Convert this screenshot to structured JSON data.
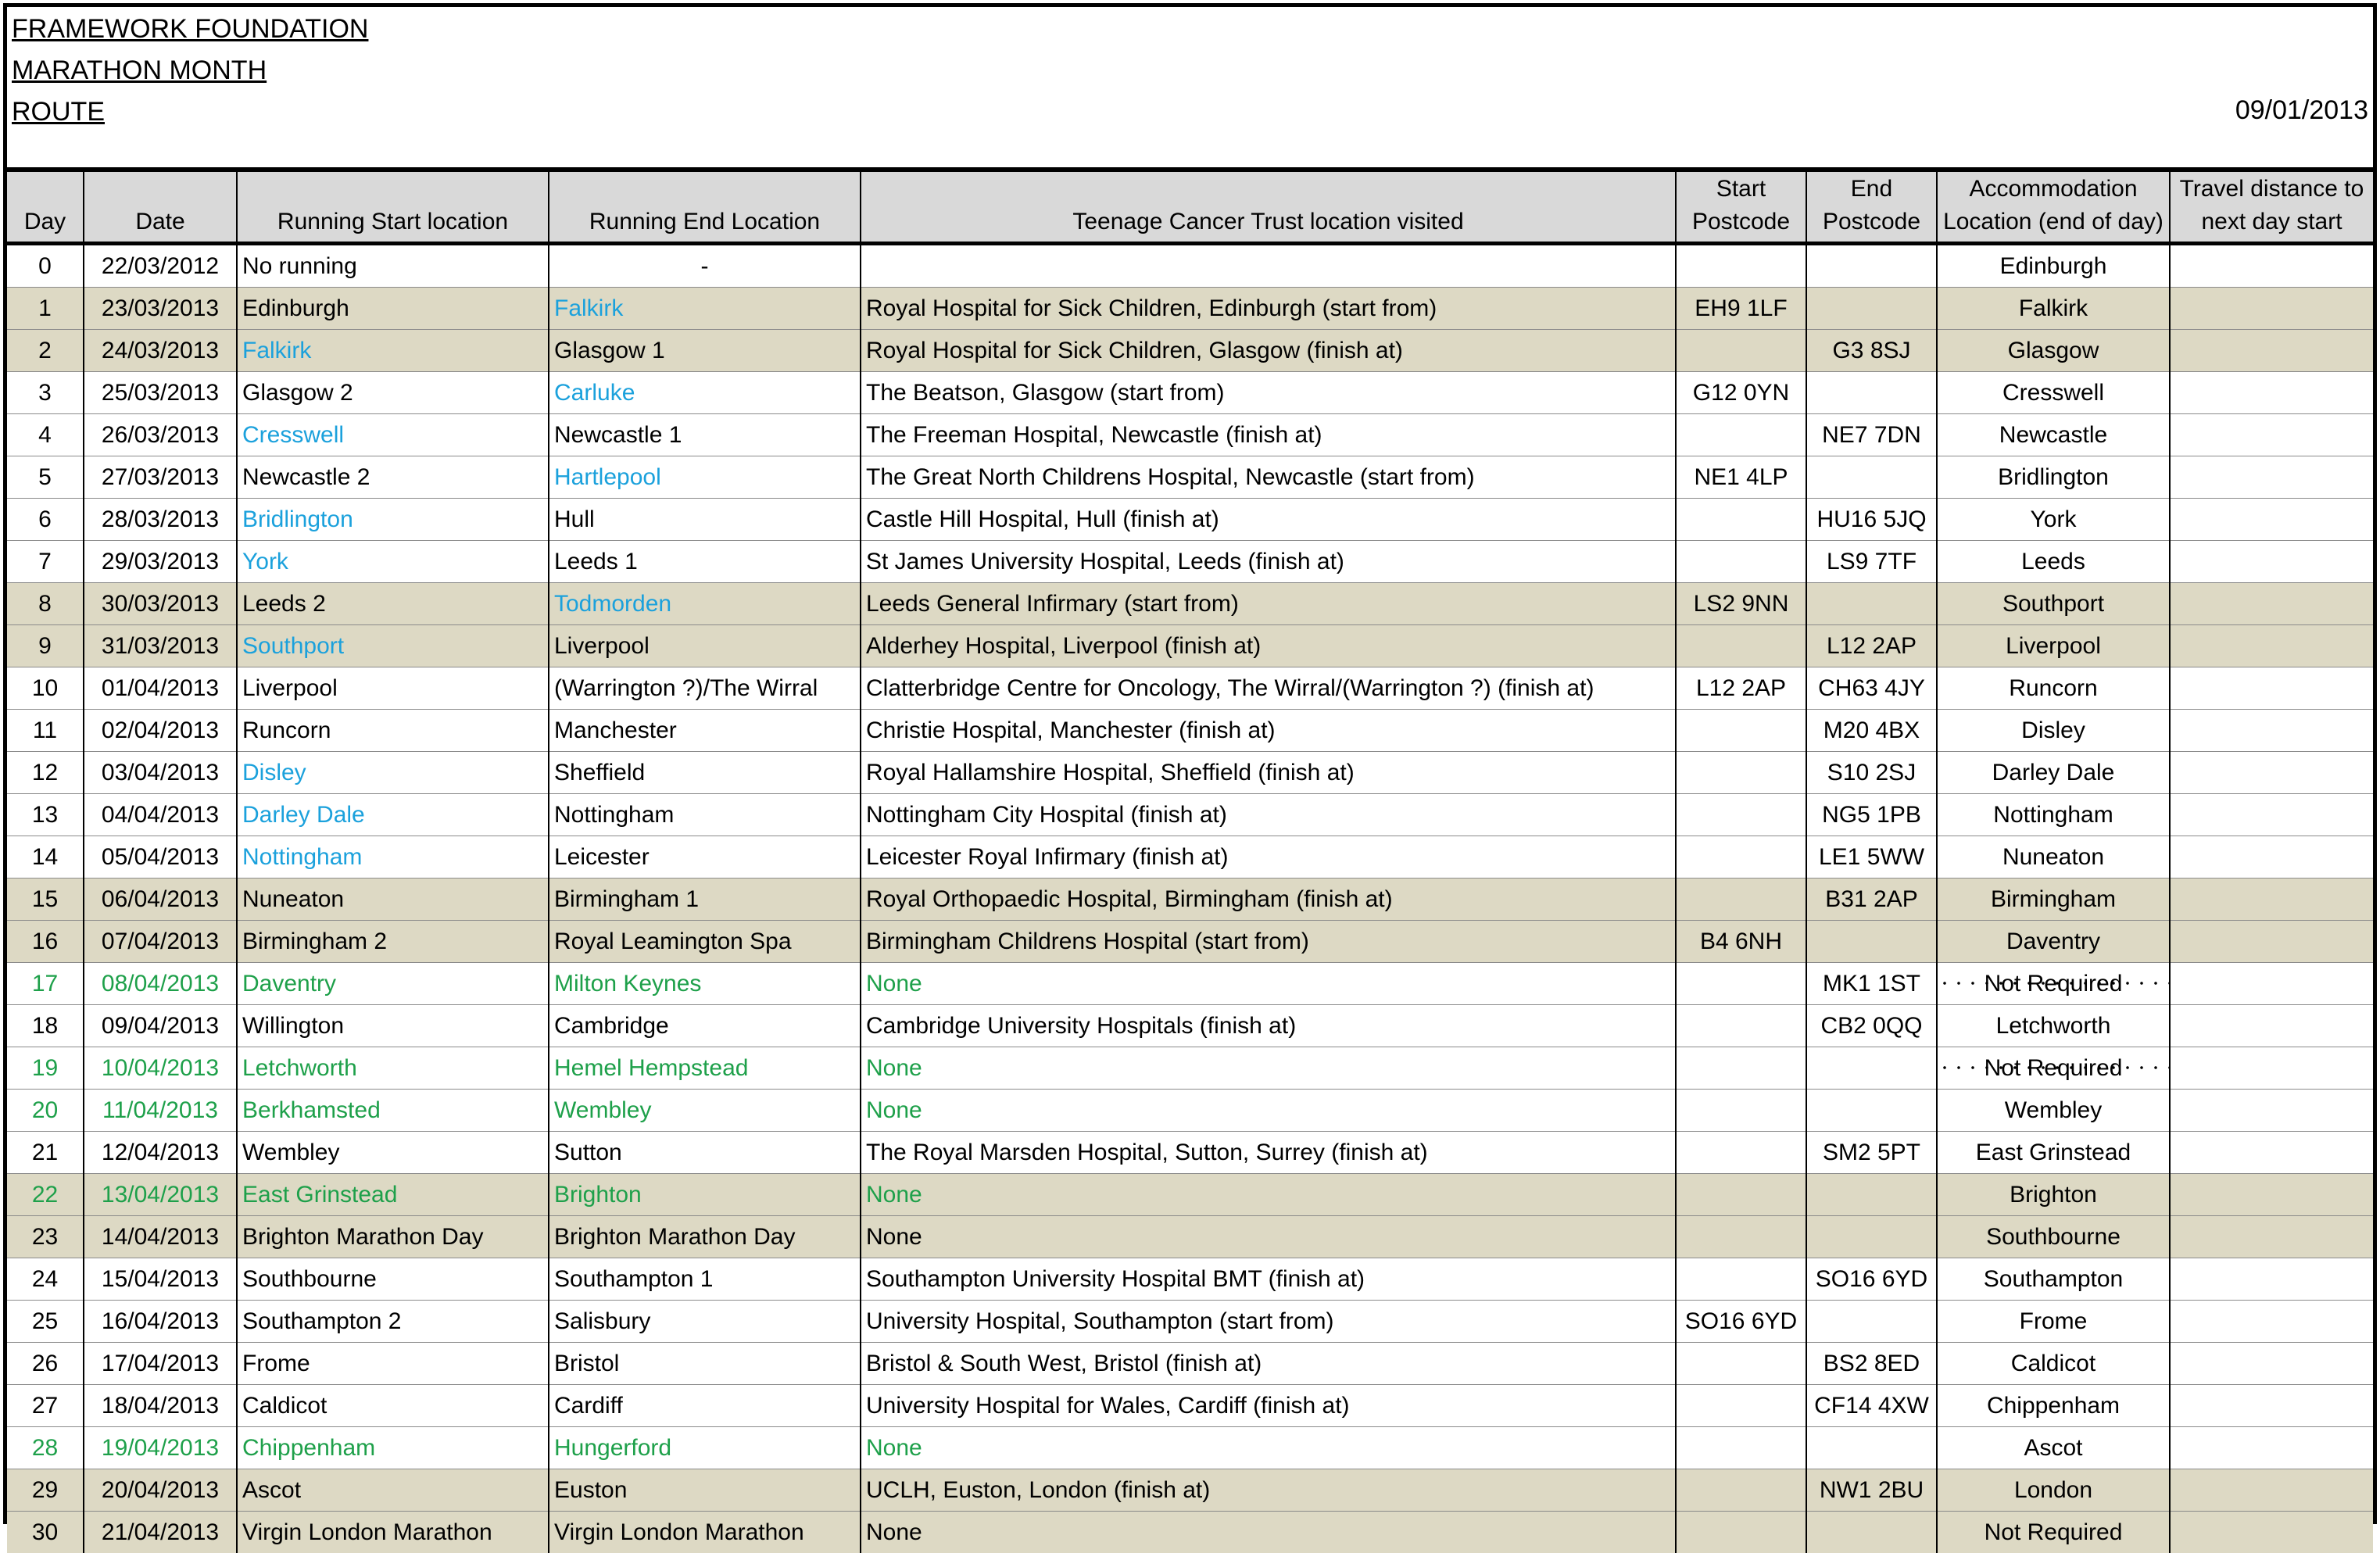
{
  "header": {
    "org_lines": [
      "FRAMEWORK FOUNDATION",
      "MARATHON MONTH",
      "ROUTE"
    ],
    "date": "09/01/2013"
  },
  "columns": [
    "Day",
    "Date",
    "Running Start location",
    "Running End Location",
    "Teenage Cancer Trust location visited",
    "Start Postcode",
    "End Postcode",
    "Accommodation Location (end of day)",
    "Travel distance to next day start"
  ],
  "colors": {
    "shaded_row": "#ddd9c4",
    "header_fill": "#d9d9d9",
    "blue_text": "#1ba1dc",
    "green_text": "#1ea04a"
  },
  "rows": [
    {
      "day": "0",
      "date": "22/03/2012",
      "start": "No running",
      "end": "-",
      "visited": "",
      "start_pc": "",
      "end_pc": "",
      "accom": "Edinburgh",
      "travel": "",
      "shaded": false,
      "green": false,
      "start_blue": false,
      "end_blue": false,
      "dotted": false
    },
    {
      "day": "1",
      "date": "23/03/2013",
      "start": "Edinburgh",
      "end": "Falkirk",
      "visited": "Royal Hospital for Sick Children, Edinburgh (start from)",
      "start_pc": "EH9 1LF",
      "end_pc": "",
      "accom": "Falkirk",
      "travel": "",
      "shaded": true,
      "green": false,
      "start_blue": false,
      "end_blue": true,
      "dotted": false
    },
    {
      "day": "2",
      "date": "24/03/2013",
      "start": "Falkirk",
      "end": "Glasgow 1",
      "visited": "Royal Hospital for Sick Children, Glasgow (finish at)",
      "start_pc": "",
      "end_pc": "G3 8SJ",
      "accom": "Glasgow",
      "travel": "",
      "shaded": true,
      "green": false,
      "start_blue": true,
      "end_blue": false,
      "dotted": false
    },
    {
      "day": "3",
      "date": "25/03/2013",
      "start": "Glasgow 2",
      "end": "Carluke",
      "visited": "The Beatson, Glasgow (start from)",
      "start_pc": "G12 0YN",
      "end_pc": "",
      "accom": "Cresswell",
      "travel": "",
      "shaded": false,
      "green": false,
      "start_blue": false,
      "end_blue": true,
      "dotted": false
    },
    {
      "day": "4",
      "date": "26/03/2013",
      "start": "Cresswell",
      "end": "Newcastle 1",
      "visited": "The Freeman Hospital, Newcastle (finish at)",
      "start_pc": "",
      "end_pc": "NE7 7DN",
      "accom": "Newcastle",
      "travel": "",
      "shaded": false,
      "green": false,
      "start_blue": true,
      "end_blue": false,
      "dotted": false
    },
    {
      "day": "5",
      "date": "27/03/2013",
      "start": "Newcastle 2",
      "end": "Hartlepool",
      "visited": "The Great North Childrens Hospital, Newcastle (start from)",
      "start_pc": "NE1 4LP",
      "end_pc": "",
      "accom": "Bridlington",
      "travel": "",
      "shaded": false,
      "green": false,
      "start_blue": false,
      "end_blue": true,
      "dotted": false
    },
    {
      "day": "6",
      "date": "28/03/2013",
      "start": "Bridlington",
      "end": "Hull",
      "visited": "Castle Hill Hospital, Hull (finish at)",
      "start_pc": "",
      "end_pc": "HU16 5JQ",
      "accom": "York",
      "travel": "",
      "shaded": false,
      "green": false,
      "start_blue": true,
      "end_blue": false,
      "dotted": false
    },
    {
      "day": "7",
      "date": "29/03/2013",
      "start": "York",
      "end": "Leeds 1",
      "visited": "St James University Hospital, Leeds (finish at)",
      "start_pc": "",
      "end_pc": "LS9 7TF",
      "accom": "Leeds",
      "travel": "",
      "shaded": false,
      "green": false,
      "start_blue": true,
      "end_blue": false,
      "dotted": false
    },
    {
      "day": "8",
      "date": "30/03/2013",
      "start": "Leeds 2",
      "end": "Todmorden",
      "visited": "Leeds General Infirmary (start from)",
      "start_pc": "LS2 9NN",
      "end_pc": "",
      "accom": "Southport",
      "travel": "",
      "shaded": true,
      "green": false,
      "start_blue": false,
      "end_blue": true,
      "dotted": false
    },
    {
      "day": "9",
      "date": "31/03/2013",
      "start": "Southport",
      "end": "Liverpool",
      "visited": "Alderhey Hospital, Liverpool (finish at)",
      "start_pc": "",
      "end_pc": "L12 2AP",
      "accom": "Liverpool",
      "travel": "",
      "shaded": true,
      "green": false,
      "start_blue": true,
      "end_blue": false,
      "dotted": false
    },
    {
      "day": "10",
      "date": "01/04/2013",
      "start": "Liverpool",
      "end": "(Warrington ?)/The Wirral",
      "visited": "Clatterbridge Centre for Oncology, The Wirral/(Warrington ?) (finish at)",
      "start_pc": "L12 2AP",
      "end_pc": "CH63 4JY",
      "accom": "Runcorn",
      "travel": "",
      "shaded": false,
      "green": false,
      "start_blue": false,
      "end_blue": false,
      "dotted": false
    },
    {
      "day": "11",
      "date": "02/04/2013",
      "start": "Runcorn",
      "end": "Manchester",
      "visited": "Christie Hospital, Manchester (finish at)",
      "start_pc": "",
      "end_pc": "M20 4BX",
      "accom": "Disley",
      "travel": "",
      "shaded": false,
      "green": false,
      "start_blue": false,
      "end_blue": false,
      "dotted": false
    },
    {
      "day": "12",
      "date": "03/04/2013",
      "start": "Disley",
      "end": "Sheffield",
      "visited": "Royal Hallamshire Hospital, Sheffield (finish at)",
      "start_pc": "",
      "end_pc": "S10 2SJ",
      "accom": "Darley Dale",
      "travel": "",
      "shaded": false,
      "green": false,
      "start_blue": true,
      "end_blue": false,
      "dotted": false
    },
    {
      "day": "13",
      "date": "04/04/2013",
      "start": "Darley Dale",
      "end": "Nottingham",
      "visited": "Nottingham City Hospital (finish at)",
      "start_pc": "",
      "end_pc": "NG5 1PB",
      "accom": "Nottingham",
      "travel": "",
      "shaded": false,
      "green": false,
      "start_blue": true,
      "end_blue": false,
      "dotted": false
    },
    {
      "day": "14",
      "date": "05/04/2013",
      "start": "Nottingham",
      "end": "Leicester",
      "visited": "Leicester Royal Infirmary (finish at)",
      "start_pc": "",
      "end_pc": "LE1 5WW",
      "accom": "Nuneaton",
      "travel": "",
      "shaded": false,
      "green": false,
      "start_blue": true,
      "end_blue": false,
      "dotted": false
    },
    {
      "day": "15",
      "date": "06/04/2013",
      "start": "Nuneaton",
      "end": "Birmingham 1",
      "visited": "Royal Orthopaedic Hospital, Birmingham (finish at)",
      "start_pc": "",
      "end_pc": "B31 2AP",
      "accom": "Birmingham",
      "travel": "",
      "shaded": true,
      "green": false,
      "start_blue": false,
      "end_blue": false,
      "dotted": false
    },
    {
      "day": "16",
      "date": "07/04/2013",
      "start": "Birmingham 2",
      "end": "Royal Leamington Spa",
      "visited": "Birmingham Childrens Hospital (start from)",
      "start_pc": "B4 6NH",
      "end_pc": "",
      "accom": "Daventry",
      "travel": "",
      "shaded": true,
      "green": false,
      "start_blue": false,
      "end_blue": false,
      "dotted": false
    },
    {
      "day": "17",
      "date": "08/04/2013",
      "start": "Daventry",
      "end": "Milton Keynes",
      "visited": "None",
      "start_pc": "",
      "end_pc": "MK1 1ST",
      "accom": "Not Required",
      "travel": "",
      "shaded": false,
      "green": true,
      "start_blue": false,
      "end_blue": false,
      "dotted": true
    },
    {
      "day": "18",
      "date": "09/04/2013",
      "start": "Willington",
      "end": "Cambridge",
      "visited": "Cambridge University Hospitals (finish at)",
      "start_pc": "",
      "end_pc": "CB2 0QQ",
      "accom": "Letchworth",
      "travel": "",
      "shaded": false,
      "green": false,
      "start_blue": false,
      "end_blue": false,
      "dotted": false
    },
    {
      "day": "19",
      "date": "10/04/2013",
      "start": "Letchworth",
      "end": "Hemel Hempstead",
      "visited": "None",
      "start_pc": "",
      "end_pc": "",
      "accom": "Not Required",
      "travel": "",
      "shaded": false,
      "green": true,
      "start_blue": false,
      "end_blue": false,
      "dotted": true
    },
    {
      "day": "20",
      "date": "11/04/2013",
      "start": "Berkhamsted",
      "end": "Wembley",
      "visited": "None",
      "start_pc": "",
      "end_pc": "",
      "accom": "Wembley",
      "travel": "",
      "shaded": false,
      "green": true,
      "start_blue": false,
      "end_blue": false,
      "dotted": false
    },
    {
      "day": "21",
      "date": "12/04/2013",
      "start": "Wembley",
      "end": "Sutton",
      "visited": "The Royal Marsden Hospital, Sutton, Surrey (finish at)",
      "start_pc": "",
      "end_pc": "SM2 5PT",
      "accom": "East Grinstead",
      "travel": "",
      "shaded": false,
      "green": false,
      "start_blue": false,
      "end_blue": false,
      "dotted": false
    },
    {
      "day": "22",
      "date": "13/04/2013",
      "start": "East Grinstead",
      "end": "Brighton",
      "visited": "None",
      "start_pc": "",
      "end_pc": "",
      "accom": "Brighton",
      "travel": "",
      "shaded": true,
      "green": true,
      "start_blue": false,
      "end_blue": false,
      "dotted": false
    },
    {
      "day": "23",
      "date": "14/04/2013",
      "start": "Brighton Marathon Day",
      "end": "Brighton Marathon Day",
      "visited": "None",
      "start_pc": "",
      "end_pc": "",
      "accom": "Southbourne",
      "travel": "",
      "shaded": true,
      "green": false,
      "start_blue": false,
      "end_blue": false,
      "dotted": false
    },
    {
      "day": "24",
      "date": "15/04/2013",
      "start": "Southbourne",
      "end": "Southampton 1",
      "visited": "Southampton University Hospital BMT (finish at)",
      "start_pc": "",
      "end_pc": "SO16 6YD",
      "accom": "Southampton",
      "travel": "",
      "shaded": false,
      "green": false,
      "start_blue": false,
      "end_blue": false,
      "dotted": false
    },
    {
      "day": "25",
      "date": "16/04/2013",
      "start": "Southampton 2",
      "end": "Salisbury",
      "visited": "University Hospital, Southampton (start from)",
      "start_pc": "SO16 6YD",
      "end_pc": "",
      "accom": "Frome",
      "travel": "",
      "shaded": false,
      "green": false,
      "start_blue": false,
      "end_blue": false,
      "dotted": false
    },
    {
      "day": "26",
      "date": "17/04/2013",
      "start": "Frome",
      "end": "Bristol",
      "visited": "Bristol & South West, Bristol (finish at)",
      "start_pc": "",
      "end_pc": "BS2 8ED",
      "accom": "Caldicot",
      "travel": "",
      "shaded": false,
      "green": false,
      "start_blue": false,
      "end_blue": false,
      "dotted": false
    },
    {
      "day": "27",
      "date": "18/04/2013",
      "start": "Caldicot",
      "end": "Cardiff",
      "visited": "University Hospital for Wales, Cardiff (finish at)",
      "start_pc": "",
      "end_pc": "CF14 4XW",
      "accom": "Chippenham",
      "travel": "",
      "shaded": false,
      "green": false,
      "start_blue": false,
      "end_blue": false,
      "dotted": false
    },
    {
      "day": "28",
      "date": "19/04/2013",
      "start": "Chippenham",
      "end": "Hungerford",
      "visited": "None",
      "start_pc": "",
      "end_pc": "",
      "accom": "Ascot",
      "travel": "",
      "shaded": false,
      "green": true,
      "start_blue": false,
      "end_blue": false,
      "dotted": false
    },
    {
      "day": "29",
      "date": "20/04/2013",
      "start": "Ascot",
      "end": "Euston",
      "visited": "UCLH, Euston, London (finish at)",
      "start_pc": "",
      "end_pc": "NW1 2BU",
      "accom": "London",
      "travel": "",
      "shaded": true,
      "green": false,
      "start_blue": false,
      "end_blue": false,
      "dotted": false
    },
    {
      "day": "30",
      "date": "21/04/2013",
      "start": "Virgin London Marathon",
      "end": "Virgin London Marathon",
      "visited": "None",
      "start_pc": "",
      "end_pc": "",
      "accom": "Not Required",
      "travel": "",
      "shaded": true,
      "green": false,
      "start_blue": false,
      "end_blue": false,
      "dotted": true
    }
  ]
}
